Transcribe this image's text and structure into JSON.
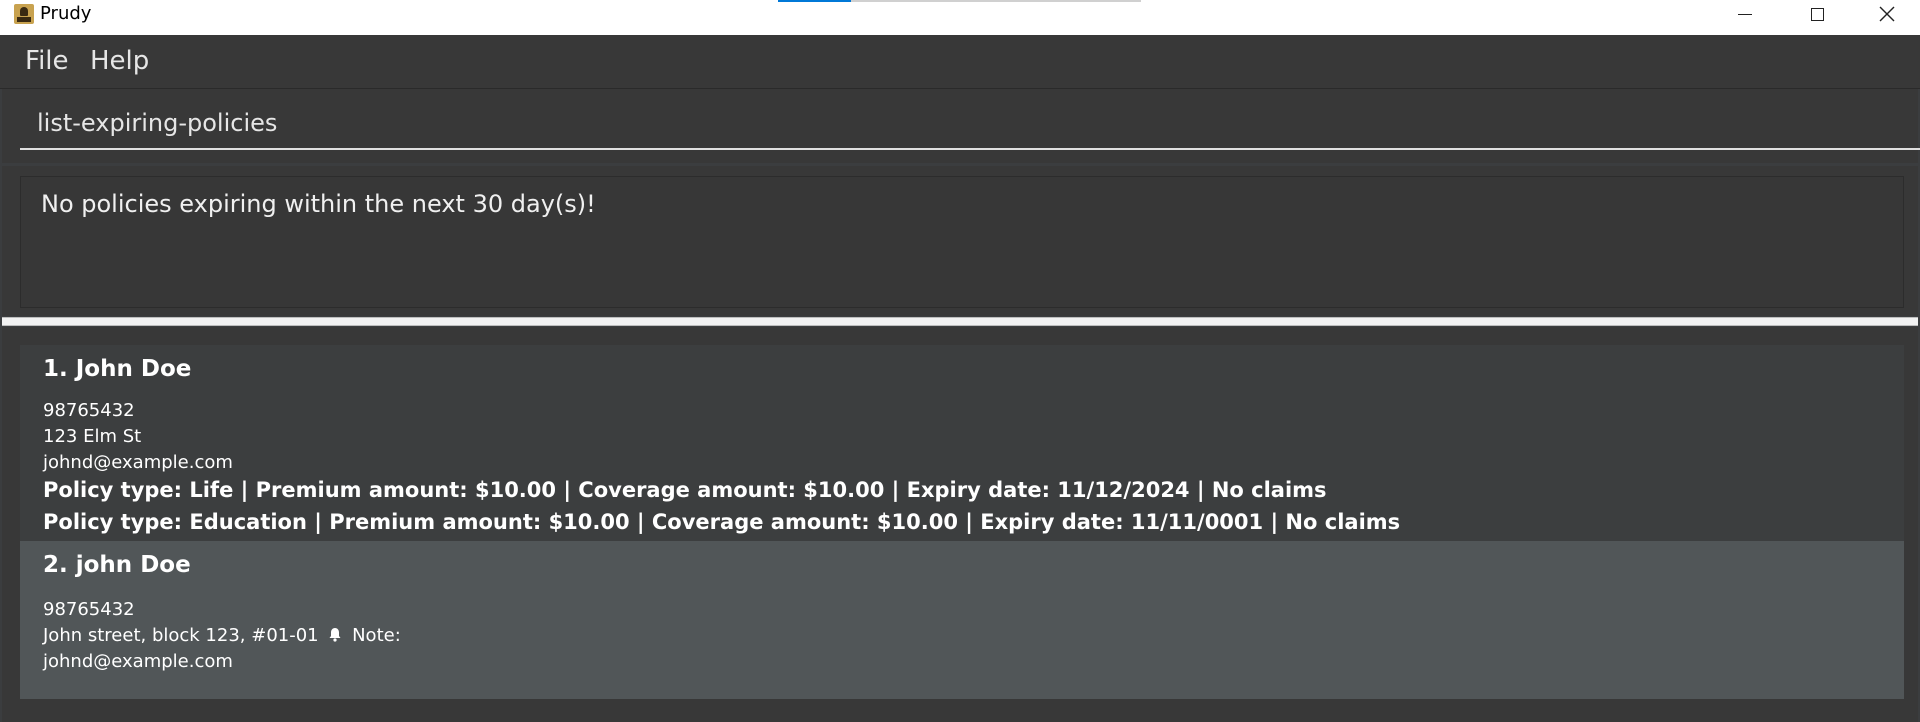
{
  "window": {
    "title": "Prudy"
  },
  "menu": {
    "file": "File",
    "help": "Help"
  },
  "command": {
    "value": "list-expiring-policies"
  },
  "result": {
    "message": "No policies expiring within the next 30 day(s)!"
  },
  "clients": [
    {
      "name": "1. John Doe",
      "phone": "98765432",
      "address": "123 Elm St",
      "email": "johnd@example.com",
      "policies": [
        "Policy type: Life | Premium amount: $10.00 | Coverage amount: $10.00 | Expiry date: 11/12/2024 | No claims",
        "Policy type: Education | Premium amount: $10.00 | Coverage amount: $10.00 | Expiry date: 11/11/0001 | No claims"
      ]
    },
    {
      "name": "2. john Doe",
      "phone": "98765432",
      "address": "John street, block 123, #01-01",
      "note_label": "Note:",
      "email": "johnd@example.com"
    }
  ]
}
